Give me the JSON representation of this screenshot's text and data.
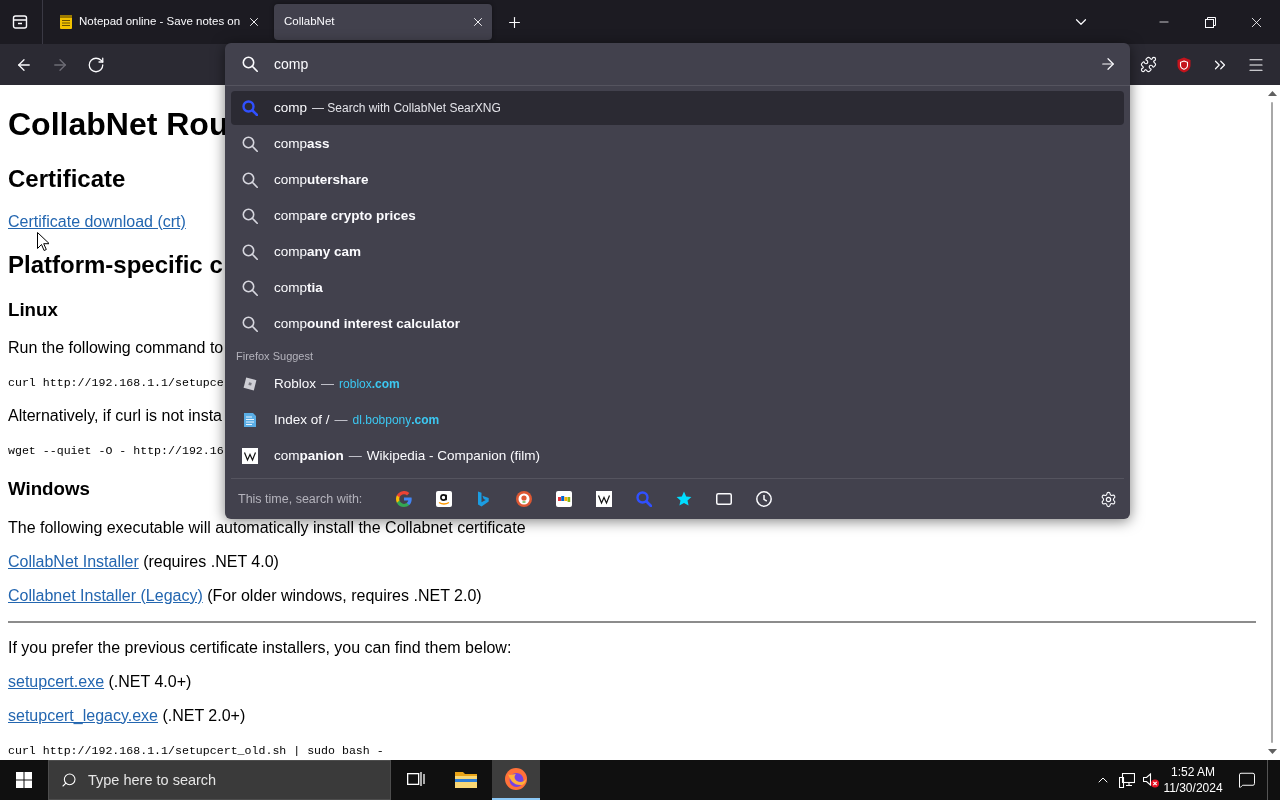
{
  "tabs": [
    {
      "title": "Notepad online - Save notes on",
      "selected": false
    },
    {
      "title": "CollabNet",
      "selected": true
    }
  ],
  "nav_buttons": [
    {
      "kind": "back",
      "disabled": false
    },
    {
      "kind": "forward",
      "disabled": true
    },
    {
      "kind": "reload",
      "disabled": false
    }
  ],
  "urlbar": {
    "value": "comp",
    "results": [
      {
        "kind": "engine",
        "title": "comp",
        "action": "— Search with CollabNet SearXNG",
        "selected": true
      },
      {
        "kind": "suggestion",
        "title": "comp**ass**",
        "selected": false
      },
      {
        "kind": "suggestion",
        "title": "comp**utershare**",
        "selected": false
      },
      {
        "kind": "suggestion",
        "title": "comp**are crypto prices**",
        "selected": false
      },
      {
        "kind": "suggestion",
        "title": "comp**any cam**",
        "selected": false
      },
      {
        "kind": "suggestion",
        "title": "comp**tia**",
        "selected": false
      },
      {
        "kind": "suggestion",
        "title": "comp**ound interest calculator**",
        "selected": false
      }
    ],
    "firefox_suggest": {
      "heading": "Firefox Suggest",
      "results": [
        {
          "title": "Roblox",
          "separator": "—",
          "url": "roblox**.com**",
          "selected": false
        },
        {
          "title": "Index of /",
          "separator": "—",
          "url": "dl.bobpony**.com**",
          "selected": false
        },
        {
          "title": "com**panion**",
          "separator": "—",
          "detail": "Wikipedia - Companion (film)",
          "selected": false
        }
      ]
    },
    "search_with": "This time, search with:"
  },
  "page": {
    "blocks": [
      {
        "kind": "h1",
        "text": "CollabNet Rou"
      },
      {
        "kind": "h2",
        "text": "Certificate"
      },
      {
        "kind": "link",
        "link": "Certificate download (crt)"
      },
      {
        "kind": "h2",
        "text": "Platform-specific c"
      },
      {
        "kind": "h3",
        "text": "Linux"
      },
      {
        "kind": "p",
        "text": "Run the following command to"
      },
      {
        "kind": "code",
        "text": "curl http://192.168.1.1/setupce"
      },
      {
        "kind": "p",
        "text": "Alternatively, if curl is not insta"
      },
      {
        "kind": "code",
        "text": "wget --quiet -O - http://192.16"
      },
      {
        "kind": "h3",
        "text": "Windows"
      },
      {
        "kind": "p",
        "text": "The following executable will automatically install the Collabnet certificate"
      },
      {
        "kind": "link",
        "link": "CollabNet Installer",
        "note": "(requires .NET 4.0)"
      },
      {
        "kind": "link",
        "link": "Collabnet Installer (Legacy)",
        "note": "(For older windows, requires .NET 2.0)"
      },
      {
        "kind": "rule"
      },
      {
        "kind": "p",
        "text": "If you prefer the previous certificate installers, you can find them below:"
      },
      {
        "kind": "link",
        "link": "setupcert.exe",
        "note": "(.NET 4.0+)"
      },
      {
        "kind": "link",
        "link": "setupcert_legacy.exe",
        "note": "(.NET 2.0+)"
      },
      {
        "kind": "code",
        "text": "curl http://192.168.1.1/setupcert_old.sh | sudo bash -"
      }
    ]
  },
  "taskbar": {
    "search_placeholder": "Type here to search",
    "apps": [
      {
        "kind": "task-view",
        "active": false
      },
      {
        "kind": "files",
        "active": false
      },
      {
        "kind": "browser",
        "active": true
      }
    ],
    "time": "1:52 AM",
    "date": "11/30/2024"
  }
}
